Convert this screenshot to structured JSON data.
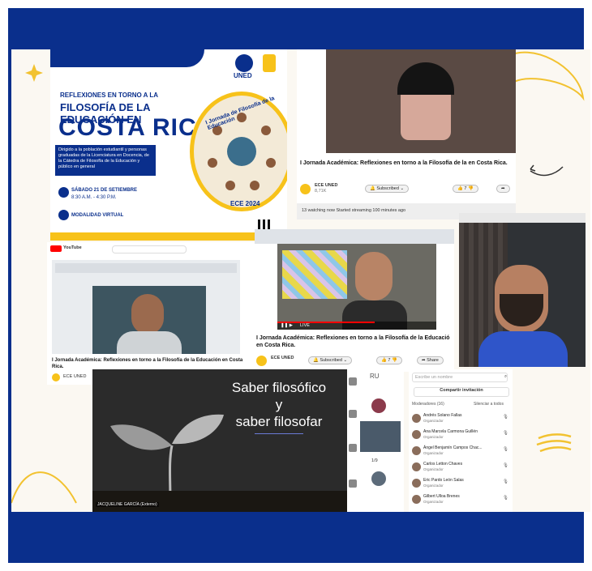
{
  "poster": {
    "brand": "UNED",
    "title_line1": "REFLEXIONES EN TORNO A LA",
    "title_line2": "FILOSOFÍA DE LA EDUCACIÓN EN",
    "title_line3": "COSTA RICA",
    "audience": "Dirigido a la población estudiantil y personas graduadas de la Licenciatura en Docencia, de la Cátedra de Filosofía de la Educación y público en general",
    "date": "SÁBADO 21 DE SETIEMBRE",
    "time": "8:30 A.M. - 4:30 P.M.",
    "mode": "MODALIDAD VIRTUAL",
    "ring_text": "I Jornada de Filosofía de la Educación",
    "footer": "ECE 2024"
  },
  "video1": {
    "title": "I Jornada Académica: Reflexiones en torno a la Filosofía de la en Costa Rica.",
    "channel": "ECE UNED",
    "subs": "8,71K",
    "subscribe": "Subscribed",
    "likes": "7",
    "status": "13 watching now  Started streaming 100 minutes ago"
  },
  "video2": {
    "title": "I Jornada Académica: Reflexiones en torno a la Filosofía de la Educació en Costa Rica.",
    "channel": "ECE UNED",
    "subscribe": "Subscribed",
    "likes": "7",
    "share": "Share",
    "live": "LIVE"
  },
  "video3": {
    "brand": "YouTube",
    "title": "I Jornada Académica: Reflexiones en torno a la Filosofía de la Educación en Costa Rica.",
    "channel": "ECE UNED"
  },
  "slide": {
    "line1": "Saber filosófico",
    "line2": "y",
    "line3": "saber filosofar",
    "caption": "JACQUELINE GARCÍA (Externo)"
  },
  "meet": {
    "ru": "RU",
    "pager": "1/9",
    "search_placeholder": "Escribe un nombre",
    "share_invite": "Compartir invitación",
    "section": "Moderadores (16)",
    "silence_all": "Silenciar a todos",
    "people": [
      {
        "name": "Andrés Solano Fallas",
        "role": "Organizador"
      },
      {
        "name": "Ana Marcela Carmona Guillén",
        "role": "Organizador"
      },
      {
        "name": "Ángel Benjamín Campos Chac...",
        "role": "Organizador"
      },
      {
        "name": "Carlos Letton Chaves",
        "role": "Organizador"
      },
      {
        "name": "Eric Pardo León Salas",
        "role": "Organizador"
      },
      {
        "name": "Gilbert Ulloa Brenes",
        "role": "Organizador"
      }
    ]
  },
  "colors": {
    "frame": "#0a2f8c",
    "accent": "#f7c21a",
    "youtube": "#ff0000"
  }
}
